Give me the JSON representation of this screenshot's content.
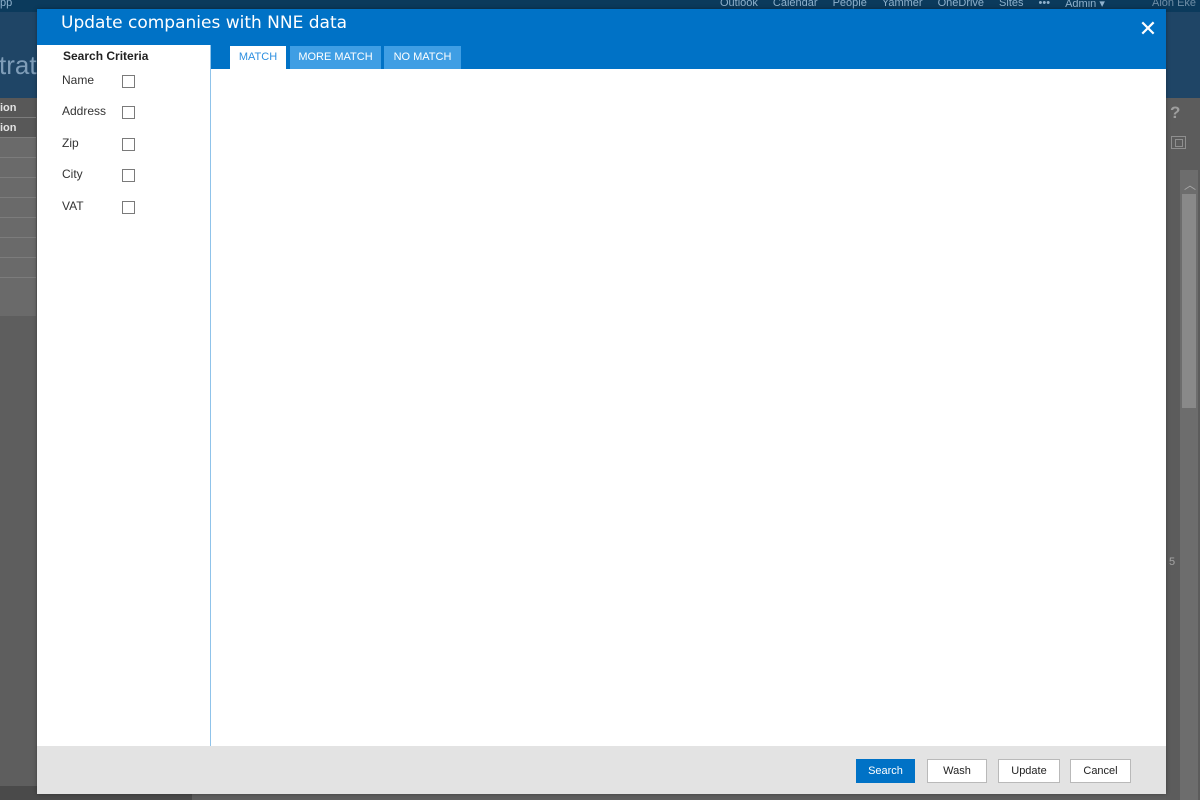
{
  "background": {
    "top_nav": {
      "app_fragment": "pp",
      "links": [
        "Outlook",
        "Calendar",
        "People",
        "Yammer",
        "OneDrive",
        "Sites",
        "•••",
        "Admin ▾"
      ],
      "user_fragment": "Alon Eke"
    },
    "page_title_fragment": "strat",
    "left_rows": [
      "ion",
      "ion",
      "",
      "",
      "",
      "",
      "",
      "",
      ""
    ],
    "right_number": "5"
  },
  "dialog": {
    "title": "Update companies with NNE data",
    "close_glyph": "✕",
    "search_criteria": {
      "heading": "Search Criteria",
      "fields": [
        {
          "label": "Name",
          "checked": false
        },
        {
          "label": "Address",
          "checked": false
        },
        {
          "label": "Zip",
          "checked": false
        },
        {
          "label": "City",
          "checked": false
        },
        {
          "label": "VAT",
          "checked": false
        }
      ]
    },
    "tabs": [
      {
        "label": "MATCH",
        "active": true
      },
      {
        "label": "MORE MATCH",
        "active": false
      },
      {
        "label": "NO MATCH",
        "active": false
      }
    ],
    "buttons": {
      "search": "Search",
      "wash": "Wash",
      "update": "Update",
      "cancel": "Cancel"
    }
  },
  "colors": {
    "header_blue": "#0072c6",
    "tab_inactive": "#3f9ee4",
    "tab_active_text": "#2d8fe0",
    "footer_gray": "#e3e3e3"
  },
  "icons": {
    "close": "close-icon",
    "help": "question-icon",
    "focus": "focus-mode-icon",
    "scroll_up": "chevron-up-icon"
  }
}
